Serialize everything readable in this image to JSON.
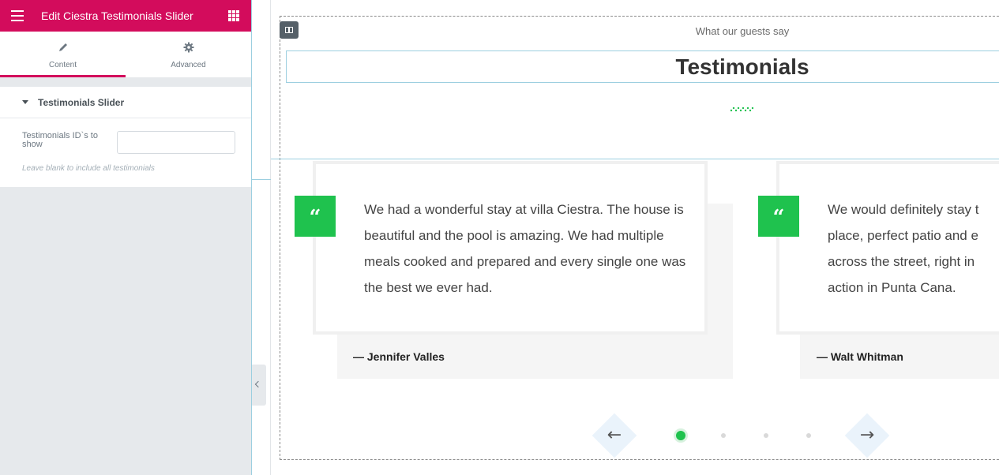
{
  "sidebar": {
    "header": {
      "title": "Edit Ciestra Testimonials Slider"
    },
    "tabs": [
      {
        "label": "Content",
        "icon": "pencil-icon",
        "active": true
      },
      {
        "label": "Advanced",
        "icon": "gear-icon",
        "active": false
      }
    ],
    "section": {
      "title": "Testimonials Slider",
      "field_label": "Testimonials ID`s to show",
      "field_value": "",
      "help_text": "Leave blank to include all testimonials"
    }
  },
  "preview": {
    "subtitle": "What our guests say",
    "title": "Testimonials",
    "testimonials": [
      {
        "quote_mark": "“",
        "text": "We had a wonderful stay at villa Ciestra. The house is beautiful and the pool is amazing. We had multiple meals cooked and prepared and every single one was the best we ever had.",
        "author": "— Jennifer Valles"
      },
      {
        "quote_mark": "“",
        "text": "We would definitely stay t place, perfect patio and e across the street, right in action in Punta Cana.",
        "author": "— Walt Whitman"
      }
    ],
    "nav": {
      "prev": "←",
      "next": "→",
      "dots": 4,
      "active_dot": 1
    }
  },
  "colors": {
    "brand": "#d30c5c",
    "accent_green": "#1fc24e",
    "guide_blue": "#9ccfe0"
  }
}
